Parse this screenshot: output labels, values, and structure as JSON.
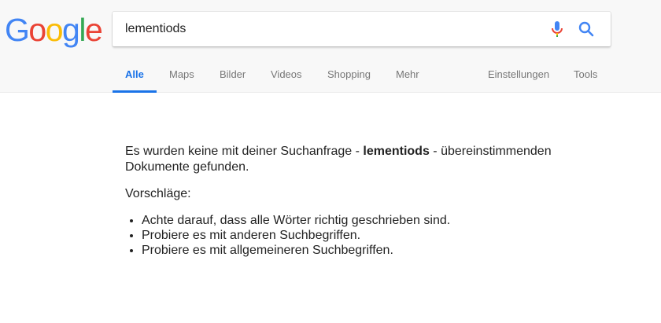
{
  "logo": {
    "letters": [
      "G",
      "o",
      "o",
      "g",
      "l",
      "e"
    ]
  },
  "search": {
    "query": "lementiods"
  },
  "icons": {
    "mic": "microphone-icon",
    "search": "search-icon"
  },
  "tabs": [
    {
      "label": "Alle",
      "active": true
    },
    {
      "label": "Maps"
    },
    {
      "label": "Bilder"
    },
    {
      "label": "Videos"
    },
    {
      "label": "Shopping"
    },
    {
      "label": "Mehr"
    }
  ],
  "tools": {
    "settings": "Einstellungen",
    "tools": "Tools"
  },
  "results": {
    "no_results_prefix": "Es wurden keine mit deiner Suchanfrage - ",
    "no_results_query": "lementiods",
    "no_results_suffix": " - übereinstimmenden Dokumente gefunden.",
    "suggestions_title": "Vorschläge:",
    "suggestions": [
      "Achte darauf, dass alle Wörter richtig geschrieben sind.",
      "Probiere es mit anderen Suchbegriffen.",
      "Probiere es mit allgemeineren Suchbegriffen."
    ]
  },
  "colors": {
    "accent": "#1a73e8",
    "logo_blue": "#4285f4",
    "logo_red": "#ea4335",
    "logo_yellow": "#fbbc05",
    "logo_green": "#34a853"
  }
}
